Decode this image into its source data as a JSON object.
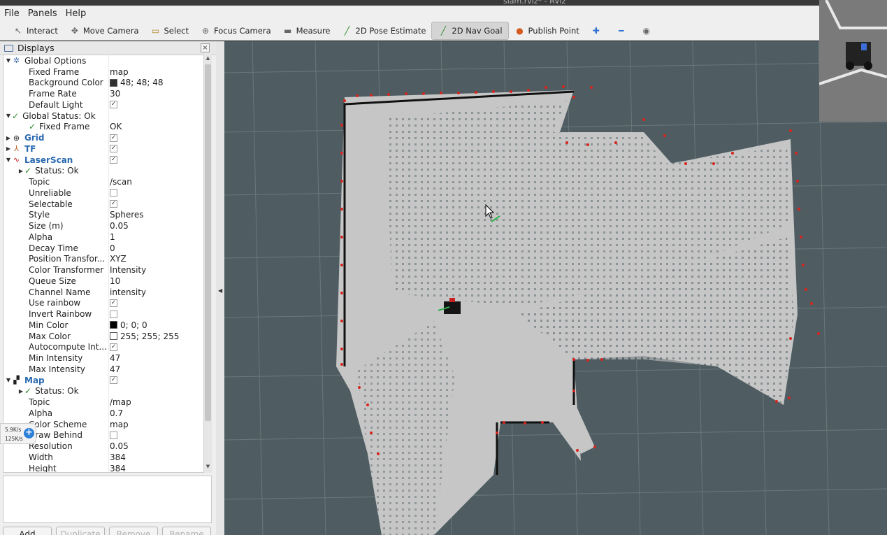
{
  "window": {
    "title": "slam.rviz* - RViz"
  },
  "menubar": {
    "file": "File",
    "panels": "Panels",
    "help": "Help"
  },
  "toolbar": {
    "tools": [
      {
        "label": "Interact",
        "icon": "cursor-icon"
      },
      {
        "label": "Move Camera",
        "icon": "move-camera-icon"
      },
      {
        "label": "Select",
        "icon": "select-icon"
      },
      {
        "label": "Focus Camera",
        "icon": "focus-camera-icon"
      },
      {
        "label": "Measure",
        "icon": "measure-icon"
      },
      {
        "label": "2D Pose Estimate",
        "icon": "pose-estimate-icon"
      },
      {
        "label": "2D Nav Goal",
        "icon": "nav-goal-icon",
        "active": true
      },
      {
        "label": "Publish Point",
        "icon": "publish-point-icon"
      }
    ]
  },
  "displays": {
    "title": "Displays",
    "close": "×",
    "rows": {
      "global_options": "Global Options",
      "fixed_frame_k": "Fixed Frame",
      "fixed_frame_v": "map",
      "bg_color_k": "Background Color",
      "bg_color_v": "48; 48; 48",
      "frame_rate_k": "Frame Rate",
      "frame_rate_v": "30",
      "default_light_k": "Default Light",
      "global_status": "Global Status: Ok",
      "gs_fixed_frame_k": "Fixed Frame",
      "gs_fixed_frame_v": "OK",
      "grid": "Grid",
      "tf": "TF",
      "laserscan": "LaserScan",
      "ls_status": "Status: Ok",
      "topic_k": "Topic",
      "topic_v": "/scan",
      "unreliable_k": "Unreliable",
      "selectable_k": "Selectable",
      "style_k": "Style",
      "style_v": "Spheres",
      "size_k": "Size (m)",
      "size_v": "0.05",
      "alpha_k": "Alpha",
      "alpha_v": "1",
      "decay_k": "Decay Time",
      "decay_v": "0",
      "pos_tf_k": "Position Transfor...",
      "pos_tf_v": "XYZ",
      "color_tf_k": "Color Transformer",
      "color_tf_v": "Intensity",
      "queue_k": "Queue Size",
      "queue_v": "10",
      "channel_k": "Channel Name",
      "channel_v": "intensity",
      "rainbow_k": "Use rainbow",
      "invert_k": "Invert Rainbow",
      "min_color_k": "Min Color",
      "min_color_v": "0; 0; 0",
      "max_color_k": "Max Color",
      "max_color_v": "255; 255; 255",
      "auto_int_k": "Autocompute Int...",
      "min_int_k": "Min Intensity",
      "min_int_v": "47",
      "max_int_k": "Max Intensity",
      "max_int_v": "47",
      "map": "Map",
      "map_status": "Status: Ok",
      "map_topic_k": "Topic",
      "map_topic_v": "/map",
      "map_alpha_k": "Alpha",
      "map_alpha_v": "0.7",
      "color_scheme_k": "Color Scheme",
      "color_scheme_v": "map",
      "draw_behind_k": "Draw Behind",
      "resolution_k": "Resolution",
      "resolution_v": "0.05",
      "width_k": "Width",
      "width_v": "384",
      "height_k": "Height",
      "height_v": "384"
    },
    "buttons": {
      "add": "Add",
      "duplicate": "Duplicate",
      "remove": "Remove",
      "rename": "Rename"
    }
  },
  "network_widget": {
    "upload": "5.9K/s",
    "download": "125K/s"
  },
  "colors": {
    "viewport_bg": "#4f5d62",
    "free_space": "#c8c8c8",
    "laser_points": "#d8241c",
    "accent": "#2a6ab0"
  }
}
